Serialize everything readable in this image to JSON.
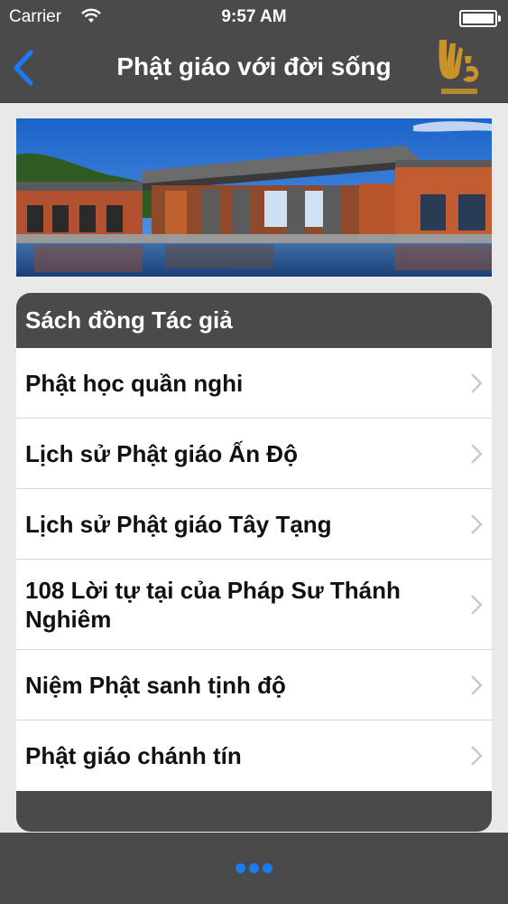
{
  "status": {
    "carrier": "Carrier",
    "time": "9:57 AM"
  },
  "nav": {
    "title": "Phật giáo với đời sống"
  },
  "section": {
    "header": "Sách đồng Tác giả"
  },
  "books": [
    {
      "title": "Phật học quần nghi"
    },
    {
      "title": "Lịch sử Phật giáo Ấn Độ"
    },
    {
      "title": "Lịch sử Phật giáo Tây Tạng"
    },
    {
      "title": "108 Lời tự tại của  Pháp Sư Thánh Nghiêm"
    },
    {
      "title": "Niệm Phật sanh tịnh độ"
    },
    {
      "title": "Phật giáo chánh tín"
    }
  ],
  "colors": {
    "bar": "#4a4a4a",
    "accent": "#1a7cf5",
    "logo": "#c8942a"
  }
}
